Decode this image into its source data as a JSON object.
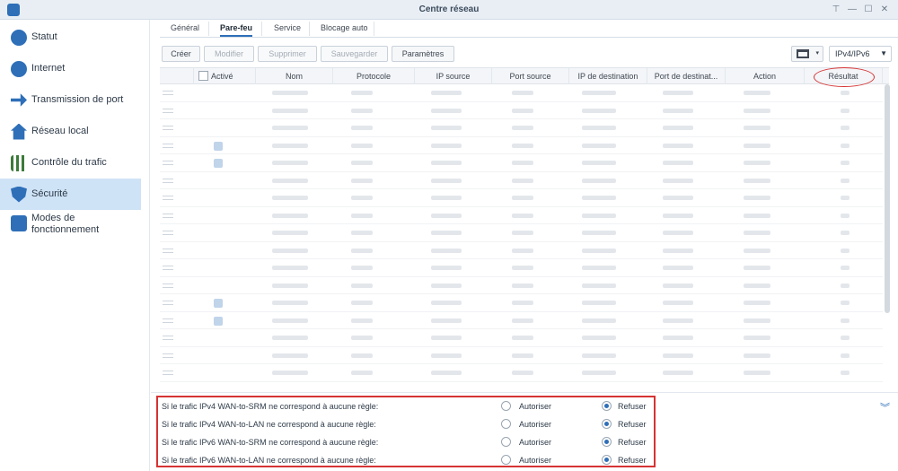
{
  "window": {
    "title": "Centre réseau"
  },
  "sidebar": {
    "items": [
      {
        "label": "Statut",
        "icon": "gauge-icon"
      },
      {
        "label": "Internet",
        "icon": "globe-icon"
      },
      {
        "label": "Transmission de port",
        "icon": "arrow-forward-icon"
      },
      {
        "label": "Réseau local",
        "icon": "home-network-icon"
      },
      {
        "label": "Contrôle du trafic",
        "icon": "sliders-icon"
      },
      {
        "label": "Sécurité",
        "icon": "shield-icon",
        "active": true
      },
      {
        "label": "Modes de fonctionnement",
        "icon": "router-mode-icon"
      }
    ]
  },
  "tabs": [
    {
      "label": "Général"
    },
    {
      "label": "Pare-feu",
      "active": true
    },
    {
      "label": "Service"
    },
    {
      "label": "Blocage auto"
    }
  ],
  "toolbar": {
    "create": "Créer",
    "edit": "Modifier",
    "delete": "Supprimer",
    "save": "Sauvegarder",
    "settings": "Paramètres",
    "ip_version": "IPv4/IPv6"
  },
  "grid": {
    "columns": [
      "Activé",
      "Nom",
      "Protocole",
      "IP source",
      "Port source",
      "IP de destination",
      "Port de destinat...",
      "Action",
      "Résultat"
    ]
  },
  "policies": [
    {
      "label": "Si le trafic IPv4 WAN-to-SRM ne correspond à aucune règle:",
      "allow": "Autoriser",
      "deny": "Refuser",
      "selected": "deny"
    },
    {
      "label": "Si le trafic IPv4 WAN-to-LAN ne correspond à aucune règle:",
      "allow": "Autoriser",
      "deny": "Refuser",
      "selected": "deny"
    },
    {
      "label": "Si le trafic IPv6 WAN-to-SRM ne correspond à aucune règle:",
      "allow": "Autoriser",
      "deny": "Refuser",
      "selected": "deny"
    },
    {
      "label": "Si le trafic IPv6 WAN-to-LAN ne correspond à aucune règle:",
      "allow": "Autoriser",
      "deny": "Refuser",
      "selected": "deny"
    }
  ],
  "colors": {
    "accent": "#2e6fb8",
    "highlight": "#d63333",
    "active_bg": "#cfe3f7"
  }
}
